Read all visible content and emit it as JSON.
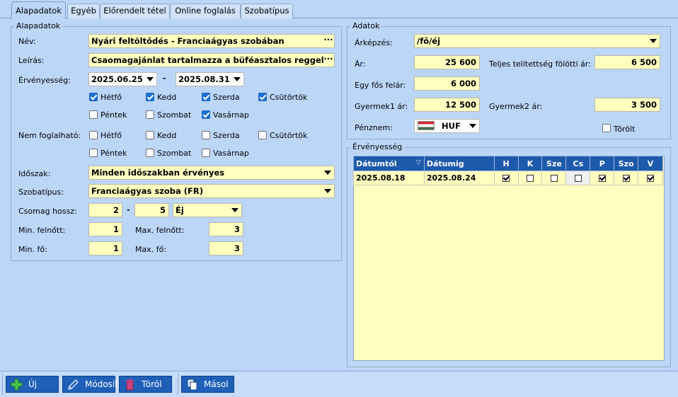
{
  "tabs": [
    "Alapadatok",
    "Egyéb",
    "Előrendelt tétel",
    "Online foglalás",
    "Szobatípus"
  ],
  "left_group": {
    "title": "Alapadatok",
    "nev_label": "Név:",
    "nev_value": "Nyári feltöltődés - Franciaágyas szobában",
    "leiras_label": "Leírás:",
    "leiras_value": "Csaomagajánlat tartalmazza a büféasztalos reggelit, személye",
    "ervenyesseg_label": "Érvényesség:",
    "date_from": "2025.06.25",
    "date_sep": "-",
    "date_to": "2025.08.31",
    "days_valid": [
      {
        "label": "Hétfő",
        "checked": true
      },
      {
        "label": "Kedd",
        "checked": true
      },
      {
        "label": "Szerda",
        "checked": true
      },
      {
        "label": "Csütörtök",
        "checked": true
      },
      {
        "label": "Péntek",
        "checked": false
      },
      {
        "label": "Szombat",
        "checked": false
      },
      {
        "label": "Vasárnap",
        "checked": true
      }
    ],
    "nem_foglalhato_label": "Nem foglalható:",
    "days_blocked": [
      {
        "label": "Hétfő",
        "checked": false
      },
      {
        "label": "Kedd",
        "checked": false
      },
      {
        "label": "Szerda",
        "checked": false
      },
      {
        "label": "Csütörtök",
        "checked": false
      },
      {
        "label": "Péntek",
        "checked": false
      },
      {
        "label": "Szombat",
        "checked": false
      },
      {
        "label": "Vasárnap",
        "checked": false
      }
    ],
    "idoszak_label": "Időszak:",
    "idoszak_value": "Minden időszakban érvényes",
    "szobatipus_label": "Szobatípus:",
    "szobatipus_value": "Franciaágyas szoba (FR)",
    "csomag_label": "Csomag hossz:",
    "csomag_min": "2",
    "csomag_sep": "-",
    "csomag_max": "5",
    "csomag_unit": "Éj",
    "min_felnott_label": "Min. felnőtt:",
    "min_felnott": "1",
    "max_felnott_label": "Max. felnőtt:",
    "max_felnott": "3",
    "min_fo_label": "Min. fő:",
    "min_fo": "1",
    "max_fo_label": "Max. fő:",
    "max_fo": "3"
  },
  "adatok": {
    "title": "Adatok",
    "arkepzes_label": "Árképzés:",
    "arkepzes_value": "/fő/éj",
    "ar_label": "Ár:",
    "ar_value": "25 600",
    "teljes_label": "Teljes telítettség fölötti ár:",
    "teljes_value": "6 500",
    "egy_fos_label": "Egy fős felár:",
    "egy_fos_value": "6 000",
    "gyermek1_label": "Gyermek1 ár:",
    "gyermek1_value": "12 500",
    "gyermek2_label": "Gyermek2 ár:",
    "gyermek2_value": "3 500",
    "penznem_label": "Pénznem:",
    "penznem_value": "HUF",
    "torolt_label": "Törölt",
    "torolt_checked": false
  },
  "ervenyesseg_grid": {
    "title": "Érvényesség",
    "columns": [
      "Dátumtól",
      "Dátumig",
      "H",
      "K",
      "Sze",
      "Cs",
      "P",
      "Szo",
      "V"
    ],
    "rows": [
      {
        "from": "2025.08.18",
        "to": "2025.08.24",
        "days": [
          true,
          false,
          false,
          false,
          true,
          true,
          true
        ]
      }
    ]
  },
  "toolbar": {
    "uj": "Új",
    "modosit": "Módosít",
    "torol": "Töröl",
    "masol": "Másol"
  }
}
